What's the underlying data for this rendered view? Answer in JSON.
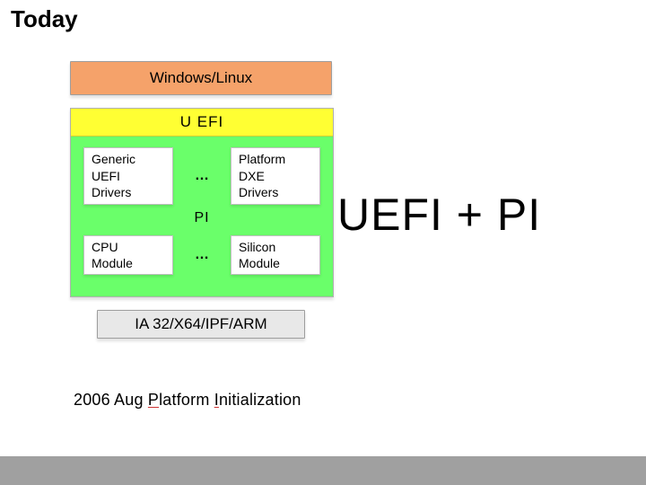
{
  "title": "Today",
  "diagram": {
    "os": "Windows/Linux",
    "uefi_band": "U EFI",
    "drivers": {
      "left": "Generic\nUEFI\nDrivers",
      "ellipsis": "…",
      "right": "Platform\nDXE\nDrivers"
    },
    "pi_band": "PI",
    "modules": {
      "left": "CPU\nModule",
      "ellipsis": "…",
      "right": "Silicon\nModule"
    },
    "arch": "IA 32/X64/IPF/ARM"
  },
  "caption": {
    "prefix": "2006 Aug ",
    "p1_initial": "P",
    "p1_rest": "latform ",
    "p2_initial": "I",
    "p2_rest": "nitialization"
  },
  "headline": "UEFI + PI"
}
